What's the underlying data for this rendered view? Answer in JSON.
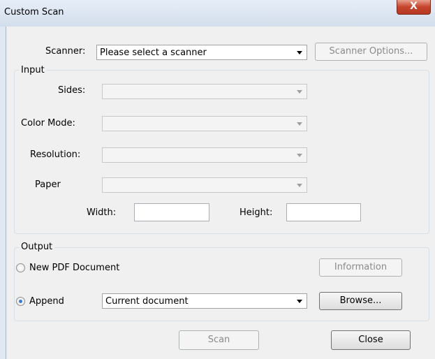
{
  "window": {
    "title": "Custom Scan",
    "close_glyph": "X"
  },
  "scanner": {
    "label": "Scanner:",
    "value": "Please select a scanner",
    "options_button": "Scanner Options..."
  },
  "input": {
    "legend": "Input",
    "sides_label": "Sides:",
    "color_mode_label": "Color Mode:",
    "resolution_label": "Resolution:",
    "paper_label": "Paper",
    "width_label": "Width:",
    "height_label": "Height:",
    "width_value": "",
    "height_value": ""
  },
  "output": {
    "legend": "Output",
    "new_pdf_label": "New PDF Document",
    "new_pdf_selected": false,
    "information_button": "Information",
    "append_label": "Append",
    "append_selected": true,
    "append_value": "Current document",
    "browse_button": "Browse..."
  },
  "footer": {
    "scan_button": "Scan",
    "close_button": "Close"
  }
}
